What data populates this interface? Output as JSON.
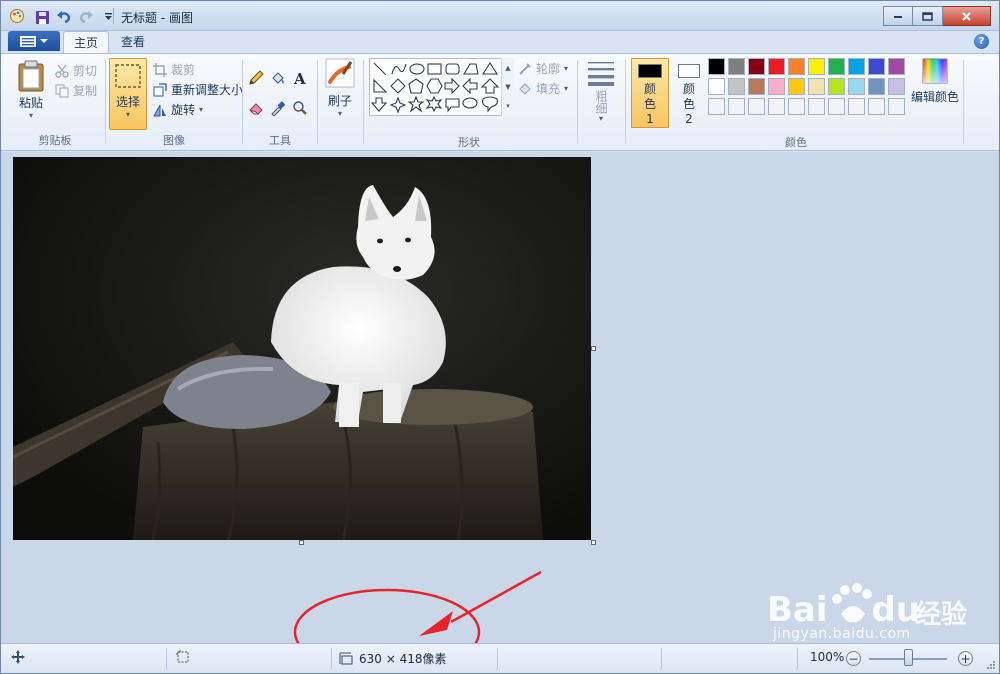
{
  "title_bar": {
    "title": "无标题 - 画图"
  },
  "tabs": [
    {
      "label": "主页",
      "active": true
    },
    {
      "label": "查看",
      "active": false
    }
  ],
  "ribbon": {
    "clipboard": {
      "group_label": "剪贴板",
      "paste_label": "粘贴",
      "cut_label": "剪切",
      "copy_label": "复制"
    },
    "image": {
      "group_label": "图像",
      "select_label": "选择",
      "crop_label": "裁剪",
      "resize_label": "重新调整大小",
      "rotate_label": "旋转"
    },
    "tools": {
      "group_label": "工具",
      "items": [
        "pencil-icon",
        "fill-icon",
        "text-icon",
        "eraser-icon",
        "color-picker-icon",
        "magnifier-icon"
      ]
    },
    "brushes": {
      "label": "刷子"
    },
    "shapes": {
      "group_label": "形状",
      "outline_label": "轮廓",
      "fill_label": "填充"
    },
    "size": {
      "label": "粗细"
    },
    "colors": {
      "group_label": "颜色",
      "color1_label": "颜色 1",
      "color2_label": "颜色 2",
      "color1_value": "#000000",
      "color2_value": "#ffffff",
      "edit_colors_label": "编辑颜色",
      "palette_row1": [
        "#000000",
        "#7f7f7f",
        "#880015",
        "#ed1c24",
        "#ff7f27",
        "#fff200",
        "#22b14c",
        "#00a2e8",
        "#3f48cc",
        "#a349a4"
      ],
      "palette_row2": [
        "#ffffff",
        "#c3c3c3",
        "#b97a57",
        "#ffaec9",
        "#ffc90e",
        "#efe4b0",
        "#b5e61d",
        "#99d9ea",
        "#7092be",
        "#c8bfe7"
      ],
      "palette_row3": [
        "",
        "",
        "",
        "",
        "",
        "",
        "",
        "",
        "",
        ""
      ]
    }
  },
  "status_bar": {
    "image_size": "630 × 418像素",
    "zoom": "100%"
  },
  "watermark": {
    "brand": "Bai",
    "brand2": "du",
    "brand_cn": "经验",
    "url": "jingyan.baidu.com"
  },
  "colors": {
    "annotation": "#e8242a",
    "accent": "#f8c560"
  }
}
